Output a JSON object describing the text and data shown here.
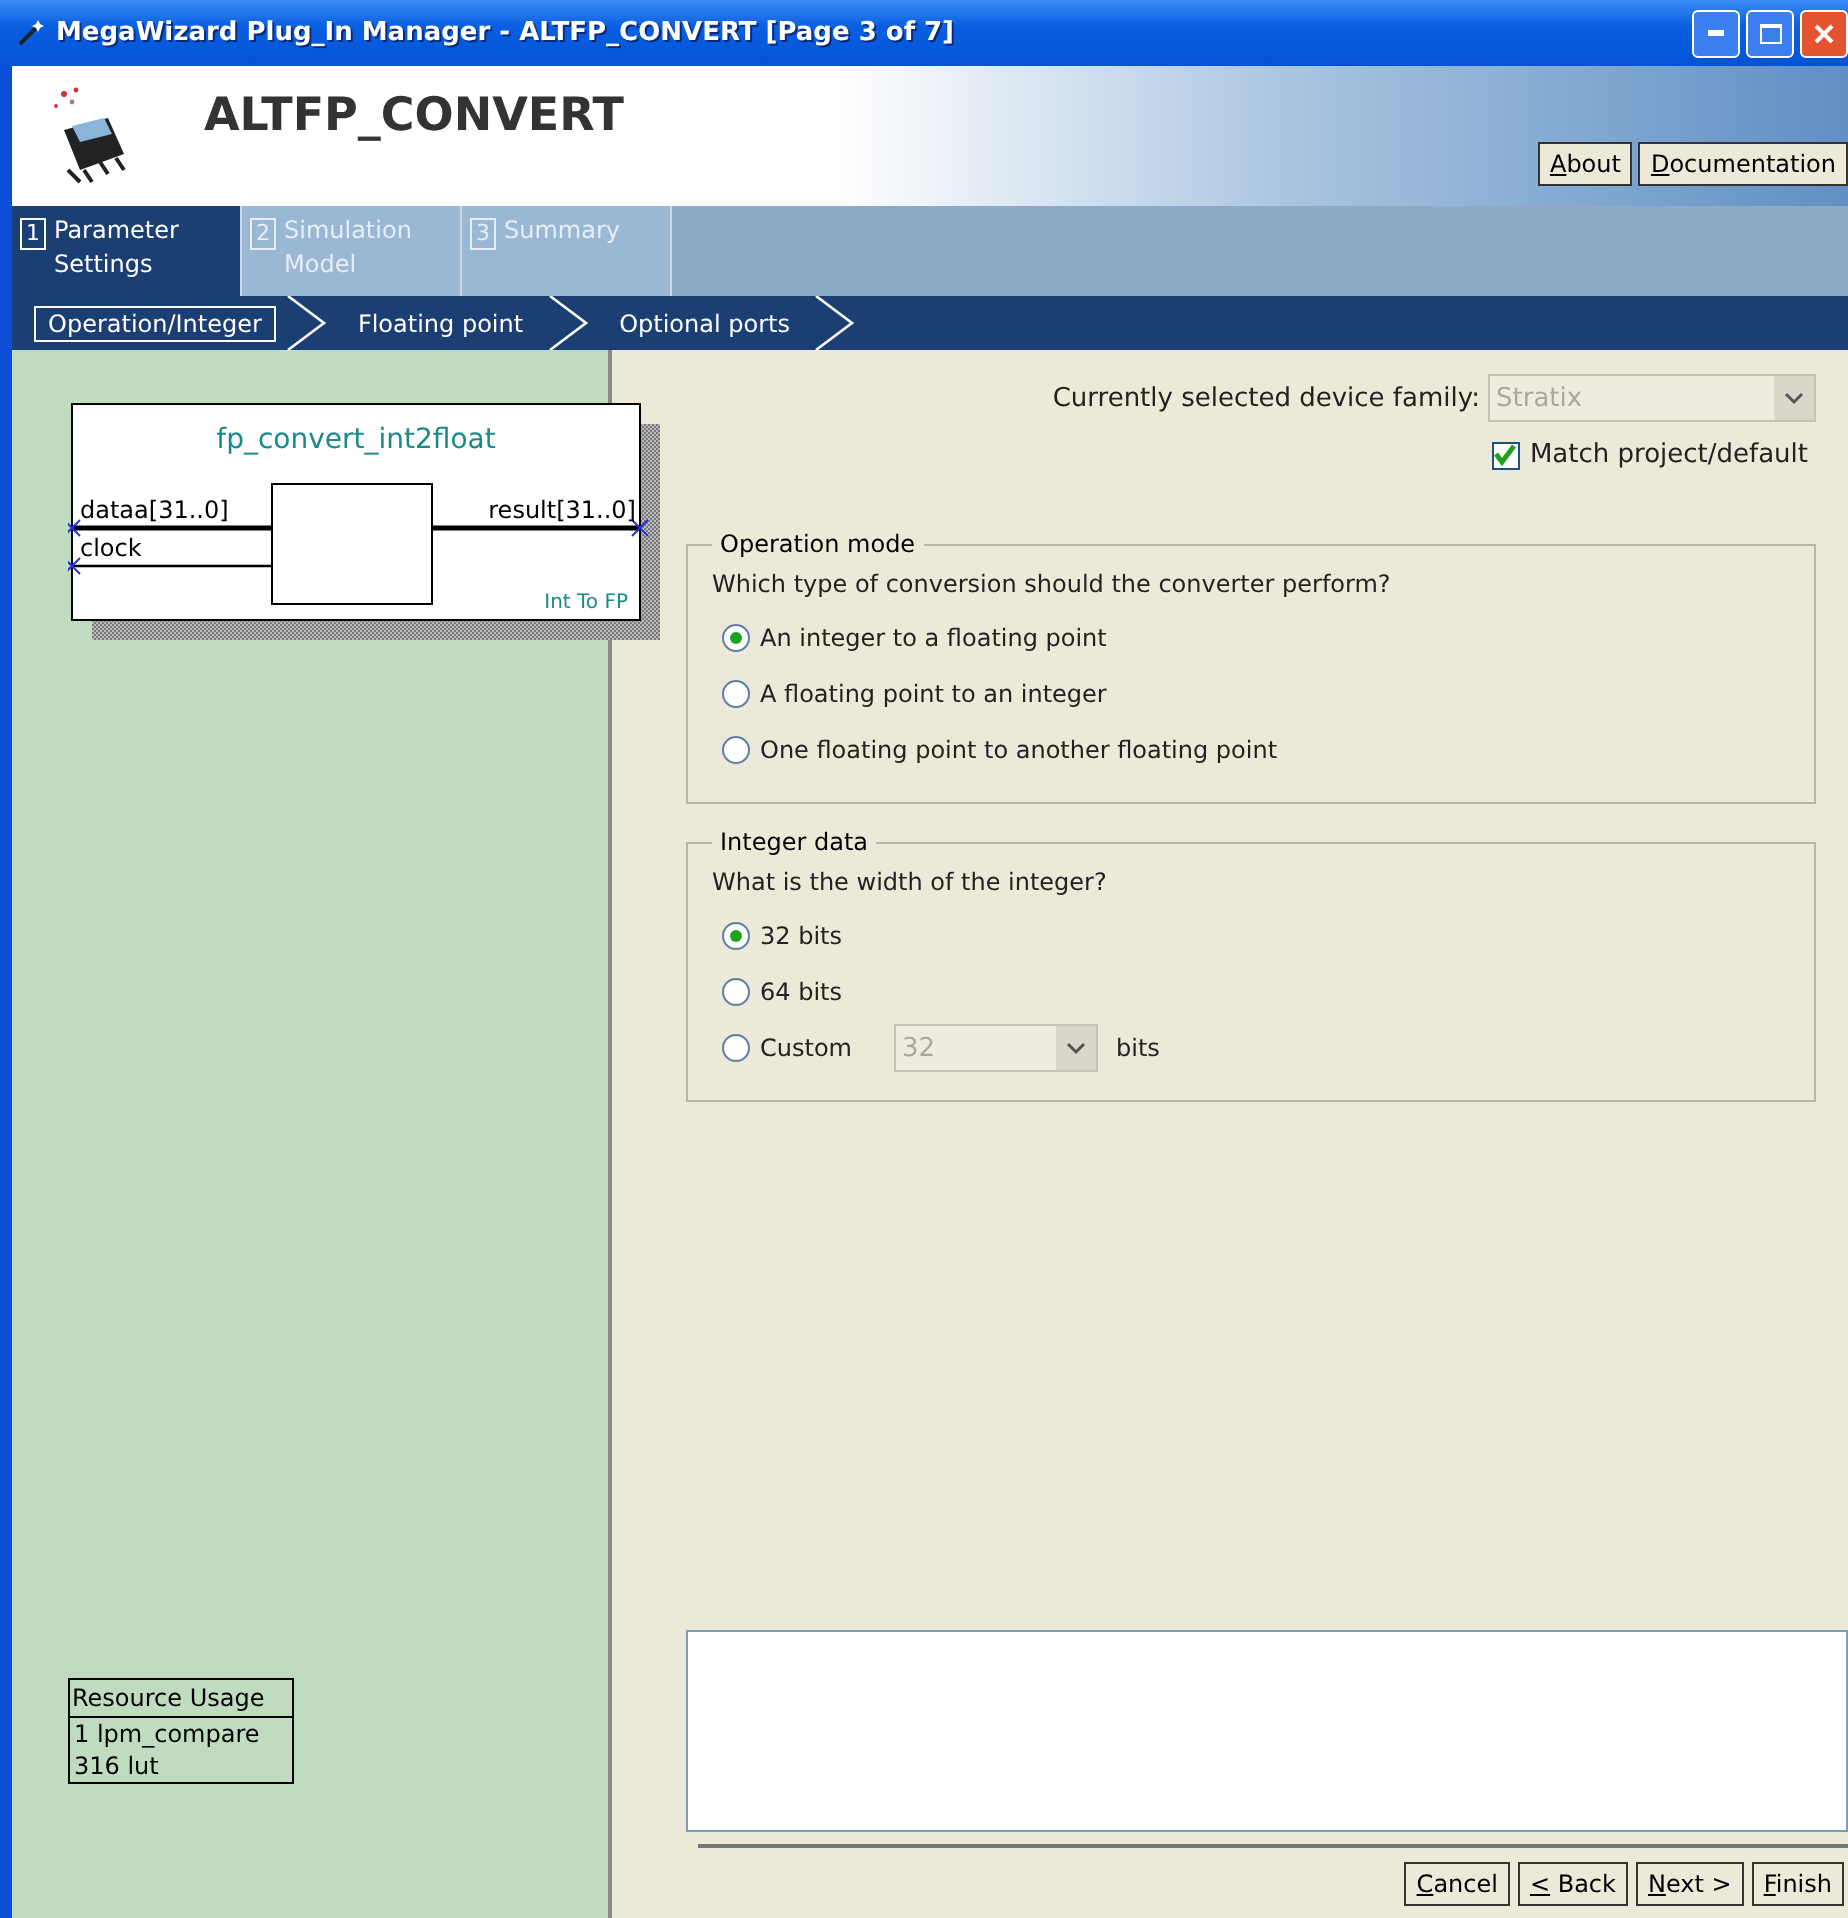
{
  "window": {
    "title": "MegaWizard Plug_In Manager - ALTFP_CONVERT [Page 3 of 7]"
  },
  "header": {
    "title": "ALTFP_CONVERT",
    "buttons": [
      "About",
      "Documentation"
    ]
  },
  "steps": [
    {
      "number": "1",
      "label": "Parameter Settings",
      "selected": true
    },
    {
      "number": "2",
      "label": "Simulation Model",
      "selected": false
    },
    {
      "number": "3",
      "label": "Summary",
      "selected": false
    }
  ],
  "breadcrumb": [
    {
      "label": "Operation/Integer",
      "selected": true
    },
    {
      "label": "Floating point",
      "selected": false
    },
    {
      "label": "Optional ports",
      "selected": false
    }
  ],
  "symbol": {
    "name": "fp_convert_int2float",
    "ports_left": [
      "dataa[31..0]",
      "clock"
    ],
    "ports_right": [
      "result[31..0]"
    ],
    "footer": "Int To FP"
  },
  "resource_usage": {
    "title": "Resource Usage",
    "lines": [
      "1 lpm_compare",
      "316 lut"
    ]
  },
  "device_family": {
    "label": "Currently selected device family:",
    "value": "Stratix",
    "disabled": true
  },
  "match_checkbox": {
    "label": "Match project/default",
    "checked": true
  },
  "groups": [
    {
      "title": "Operation mode",
      "question": "Which type of conversion should the converter perform?",
      "options": [
        {
          "kind": "radio",
          "label": "An integer to a floating point",
          "selected": true
        },
        {
          "kind": "radio",
          "label": "A floating point to an integer",
          "selected": false
        },
        {
          "kind": "radio",
          "label": "One floating point to another floating point",
          "selected": false
        }
      ]
    },
    {
      "title": "Integer data",
      "question": "What is the width of the integer?",
      "options": [
        {
          "kind": "radio",
          "label": "32 bits",
          "selected": true
        },
        {
          "kind": "radio",
          "label": "64 bits",
          "selected": false
        },
        {
          "kind": "custom",
          "label": "Custom",
          "selected": false,
          "value": "32",
          "suffix": "bits",
          "disabled": true
        }
      ]
    }
  ],
  "buttons": [
    "Cancel",
    "< Back",
    "Next >",
    "Finish"
  ]
}
